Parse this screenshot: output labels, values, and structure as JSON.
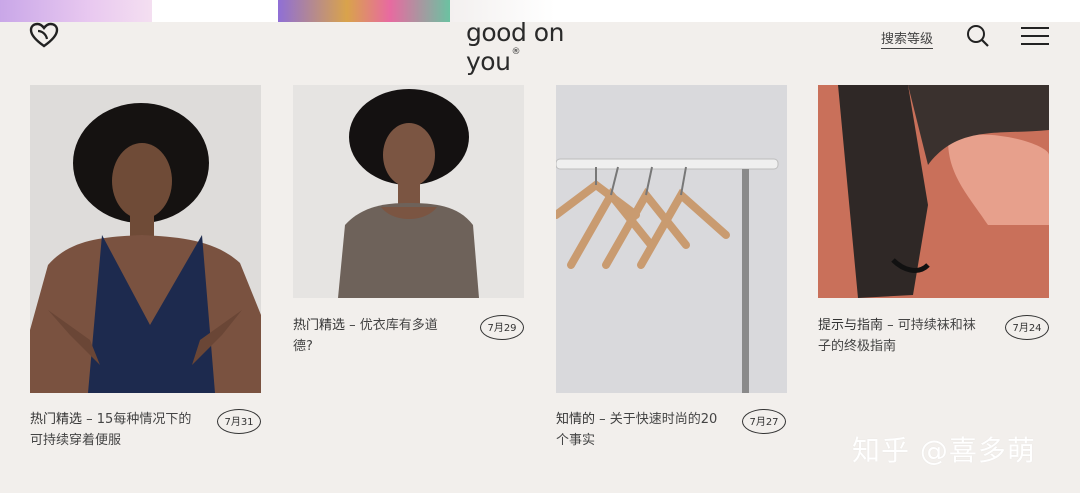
{
  "header": {
    "brand": "good on you",
    "brand_mark": "®",
    "search_rank_label": "搜索等级",
    "icons": [
      "heart-logo-icon",
      "search-icon",
      "menu-icon"
    ]
  },
  "cards": [
    {
      "category": "热门精选",
      "title_line1": " – 15每种情况下的",
      "title_line2": "可持续穿着便服",
      "date": "7月31"
    },
    {
      "category": "热门精选",
      "title_line1": " – 优衣库有多道",
      "title_line2": "德?",
      "date": "7月29"
    },
    {
      "category": "知情的",
      "title_line1": " – 关于快速时尚的20",
      "title_line2": "个事实",
      "date": "7月27"
    },
    {
      "category": "提示与指南",
      "title_line1": " – 可持续袜和袜",
      "title_line2": "子的终极指南",
      "date": "7月24"
    }
  ],
  "watermark": "知乎 @喜多萌",
  "colors": {
    "background": "#f2efec",
    "text": "#333333"
  }
}
